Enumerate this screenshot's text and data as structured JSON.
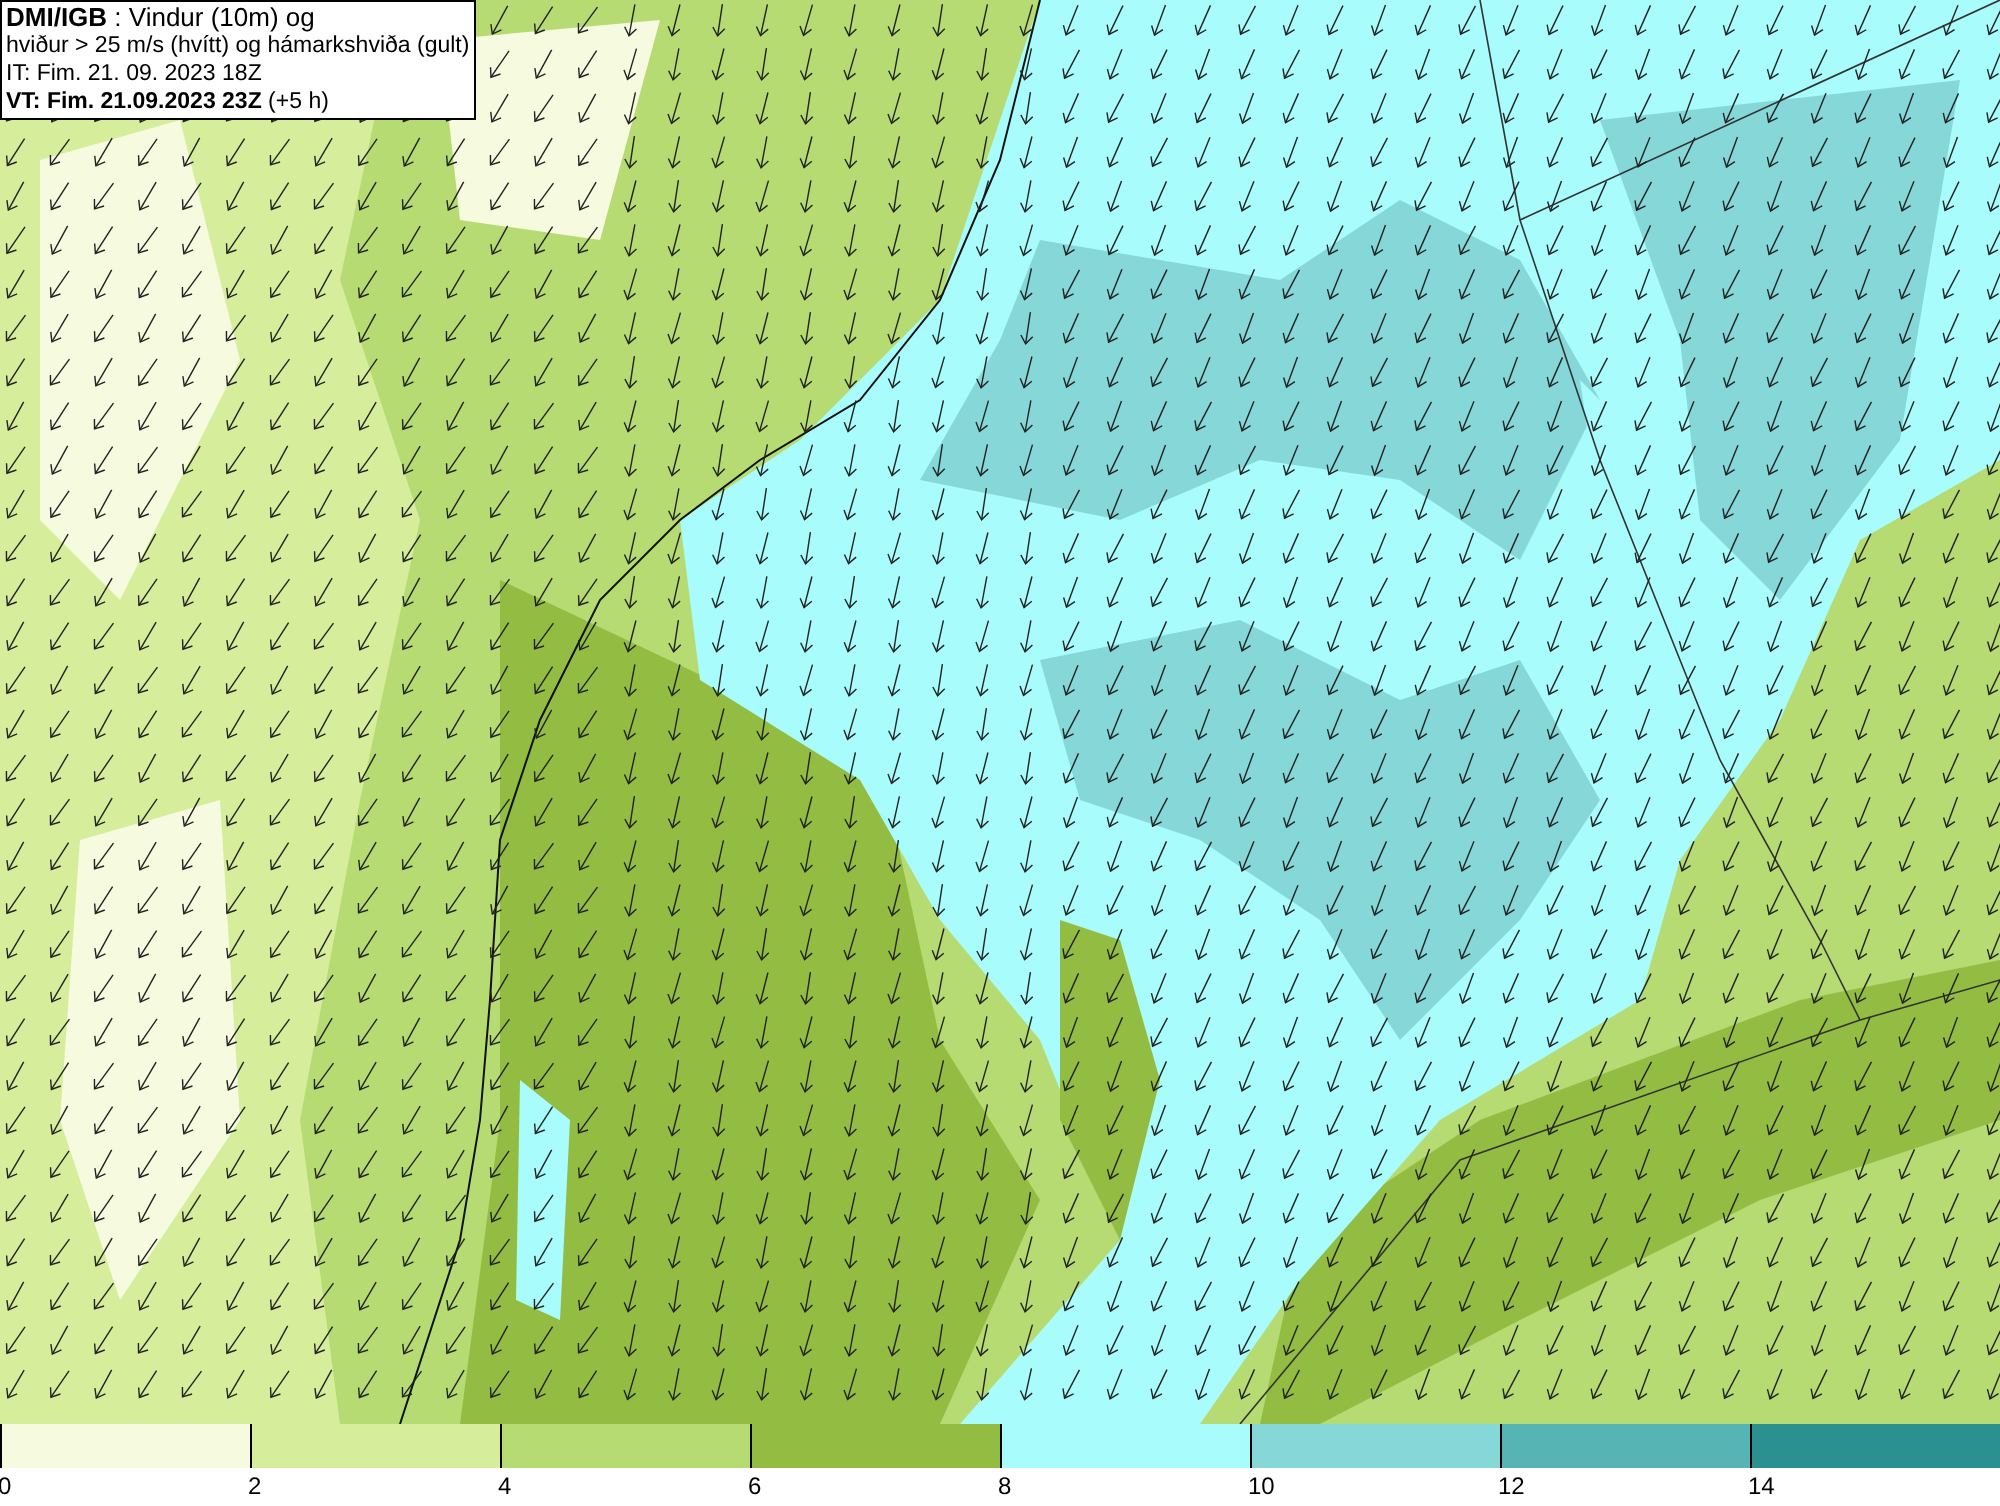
{
  "info_box": {
    "lines": [
      "**DMI/IGB** : Vindur (10m) og",
      "hviður > 25 m/s (hvítt) og hámarkshviða (gult)",
      "IT: Fim. 21. 09. 2023 18Z",
      "**VT: Fim. 21.09.2023 23Z** (+5 h)"
    ]
  },
  "legend": [
    {
      "label": "0",
      "color": "#f6fbe0"
    },
    {
      "label": "2",
      "color": "#d6ee9c"
    },
    {
      "label": "4",
      "color": "#b6db72"
    },
    {
      "label": "6",
      "color": "#93bd42"
    },
    {
      "label": "8",
      "color": "#a8fcfc"
    },
    {
      "label": "10",
      "color": "#86d8d8"
    },
    {
      "label": "12",
      "color": "#56b4b4"
    },
    {
      "label": "14",
      "color": "#2a9090"
    }
  ]
}
